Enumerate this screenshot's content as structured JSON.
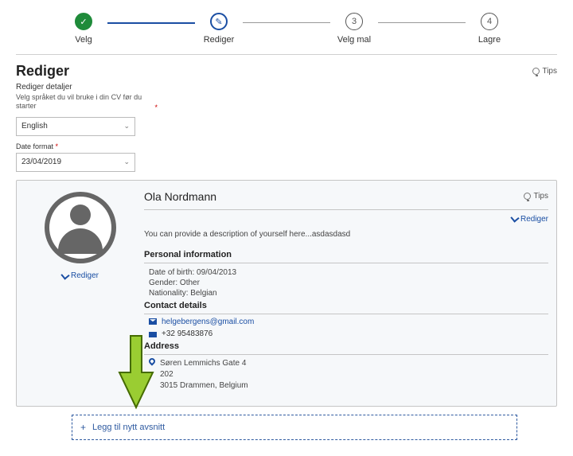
{
  "stepper": {
    "steps": [
      {
        "label": "Velg",
        "mark": "✓"
      },
      {
        "label": "Rediger",
        "mark": "✎"
      },
      {
        "label": "Velg mal",
        "mark": "3"
      },
      {
        "label": "Lagre",
        "mark": "4"
      }
    ]
  },
  "page_title": "Rediger",
  "subhead": "Rediger detaljer",
  "hint": "Velg språket du vil bruke i din CV før du starter",
  "tips_label": "Tips",
  "language_field": {
    "label": "",
    "value": "English"
  },
  "date_field": {
    "label": "Date format",
    "value": "23/04/2019"
  },
  "profile": {
    "name": "Ola Nordmann",
    "tips_label": "Tips",
    "edit_label": "Rediger",
    "avatar_edit_label": "Rediger",
    "description": "You can provide a description of yourself here...asdasdasd",
    "personal_title": "Personal information",
    "dob_label": "Date of birth:",
    "dob_value": "09/04/2013",
    "gender_label": "Gender:",
    "gender_value": "Other",
    "nationality_label": "Nationality:",
    "nationality_value": "Belgian",
    "contact_title": "Contact details",
    "email": "helgebergens@gmail.com",
    "phone": "+32 95483876",
    "address_title": "Address",
    "address_line1": "Søren Lemmichs Gate 4",
    "address_line2": "202",
    "address_line3": "3015 Drammen, Belgium"
  },
  "add_section_label": "Legg til nytt avsnitt"
}
